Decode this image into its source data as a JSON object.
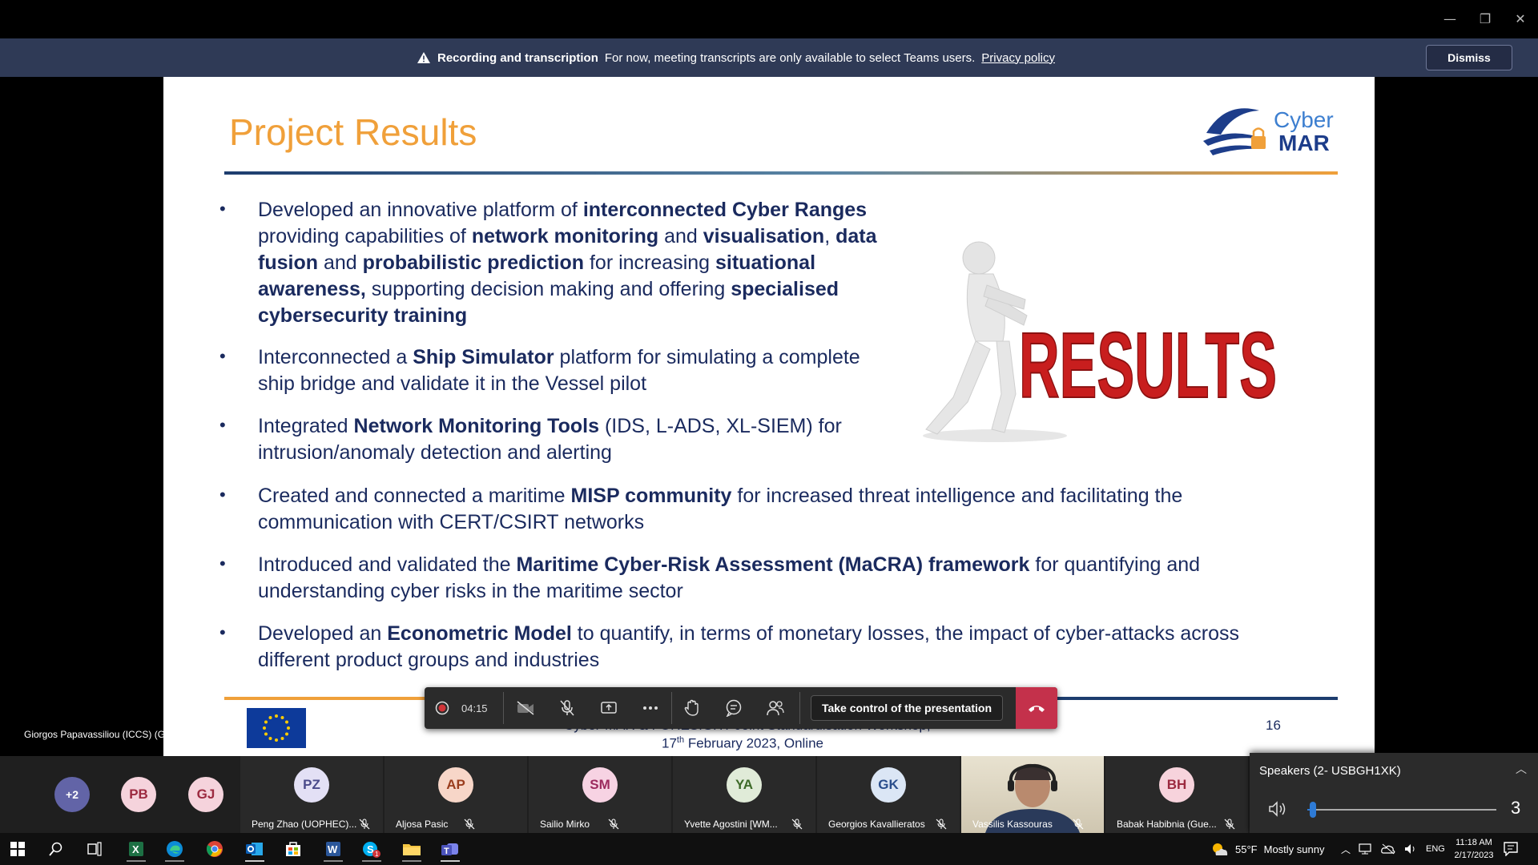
{
  "window": {
    "minimize_glyph": "—",
    "restore_glyph": "❐",
    "close_glyph": "✕"
  },
  "banner": {
    "title": "Recording and transcription",
    "message": "For now, meeting transcripts are only available to select Teams users.",
    "link": "Privacy policy",
    "dismiss": "Dismiss"
  },
  "slide": {
    "title": "Project Results",
    "logo": {
      "line1": "Cyber",
      "line2": "MAR"
    },
    "art_text": "RESULTS",
    "bullets": [
      {
        "lines": [
          [
            {
              "t": "Developed an innovative platform of "
            },
            {
              "t": "interconnected Cyber Ranges",
              "b": true
            }
          ],
          [
            {
              "t": "providing capabilities of "
            },
            {
              "t": "network monitoring",
              "b": true
            },
            {
              "t": " and "
            },
            {
              "t": "visualisation",
              "b": true
            },
            {
              "t": ", "
            },
            {
              "t": "data",
              "b": true
            }
          ],
          [
            {
              "t": "fusion",
              "b": true
            },
            {
              "t": " and "
            },
            {
              "t": "probabilistic prediction",
              "b": true
            },
            {
              "t": " for increasing "
            },
            {
              "t": "situational",
              "b": true
            }
          ],
          [
            {
              "t": "awareness,",
              "b": true
            },
            {
              "t": " supporting decision making and offering "
            },
            {
              "t": "specialised",
              "b": true
            }
          ],
          [
            {
              "t": "cybersecurity training",
              "b": true
            }
          ]
        ]
      },
      {
        "lines": [
          [
            {
              "t": "Interconnected a "
            },
            {
              "t": "Ship Simulator",
              "b": true
            },
            {
              "t": " platform for simulating a complete"
            }
          ],
          [
            {
              "t": "ship bridge and validate it in the Vessel pilot"
            }
          ]
        ]
      },
      {
        "lines": [
          [
            {
              "t": "Integrated "
            },
            {
              "t": "Network Monitoring Tools",
              "b": true
            },
            {
              "t": " (IDS, L-ADS, XL-SIEM) for"
            }
          ],
          [
            {
              "t": "intrusion/anomaly detection and alerting"
            }
          ]
        ]
      },
      {
        "lines": [
          [
            {
              "t": "Created and connected a maritime "
            },
            {
              "t": "MISP community",
              "b": true
            },
            {
              "t": " for increased threat intelligence and facilitating the"
            }
          ],
          [
            {
              "t": "communication with CERT/CSIRT networks"
            }
          ]
        ]
      },
      {
        "lines": [
          [
            {
              "t": "Introduced and validated the "
            },
            {
              "t": "Maritime Cyber-Risk Assessment (MaCRA) framework",
              "b": true
            },
            {
              "t": " for quantifying and"
            }
          ],
          [
            {
              "t": "understanding cyber risks in the maritime sector"
            }
          ]
        ]
      },
      {
        "lines": [
          [
            {
              "t": "Developed an "
            },
            {
              "t": "Econometric Model",
              "b": true
            },
            {
              "t": " to quantify, in terms of monetary losses, the impact of cyber-attacks across"
            }
          ],
          [
            {
              "t": "different product groups and industries"
            }
          ]
        ]
      }
    ],
    "footer_line1": "Cyber-MAR & FORESIGHT Joint Standardisation Workshop,",
    "footer_day": "17",
    "footer_sup": "th",
    "footer_rest": " February 2023, Online",
    "page_number": "16"
  },
  "presenter_name": "Giorgos Papavassiliou (ICCS) (Guest)",
  "toolbar": {
    "recording_time": "04:15",
    "take_control": "Take control of the presentation"
  },
  "participants": {
    "overflow": "+2",
    "small": [
      {
        "initials": "PB",
        "color": "#f5d3dc"
      },
      {
        "initials": "GJ",
        "color": "#f5d3dc"
      }
    ],
    "tiles": [
      {
        "initials": "PZ",
        "name": "Peng Zhao (UOPHEC)...",
        "color": "#e3e0f5",
        "fg": "#4a4a8a"
      },
      {
        "initials": "AP",
        "name": "Aljosa Pasic",
        "color": "#f7d6c8",
        "fg": "#9a3d1e"
      },
      {
        "initials": "SM",
        "name": "Sailio Mirko",
        "color": "#f7d3e3",
        "fg": "#9c2a5e"
      },
      {
        "initials": "YA",
        "name": "Yvette Agostini [WM...",
        "color": "#e0ebd8",
        "fg": "#3d6a28"
      },
      {
        "initials": "GK",
        "name": "Georgios Kavallieratos",
        "color": "#dbe6f5",
        "fg": "#2a4e8c"
      },
      {
        "initials": "",
        "name": "Vassilis Kassouras",
        "color": "#3a3a3a",
        "fg": "#fff"
      },
      {
        "initials": "BH",
        "name": "Babak Habibnia (Gue...",
        "color": "#f7d3dc",
        "fg": "#9c2a40"
      }
    ]
  },
  "speakers": {
    "label": "Speakers (2- USBGH1XK)",
    "volume": 3,
    "volume_fraction": 0.03
  },
  "taskbar": {
    "weather_temp": "55°F",
    "weather_text": "Mostly sunny",
    "lang": "ENG",
    "time": "11:18 AM",
    "date": "2/17/2023",
    "skype_badge": "1"
  },
  "colors": {
    "accent_orange": "#f0a03a",
    "navy": "#1a2a5e",
    "teams_purple": "#6264a7",
    "hangup_red": "#c4314b"
  }
}
